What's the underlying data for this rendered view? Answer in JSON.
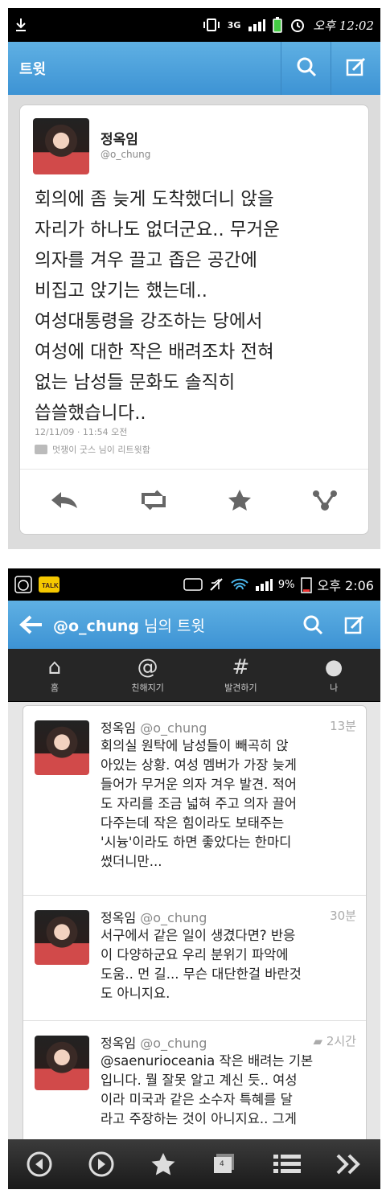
{
  "screen1": {
    "status_time": "오후 12:02",
    "header_title": "트윗",
    "tweet": {
      "name": "정옥임",
      "handle": "@o_chung",
      "lines": [
        "회의에 좀 늦게 도착했더니 앉을",
        "자리가 하나도 없더군요.. 무거운",
        "의자를 겨우 끌고 좁은 공간에",
        "비집고 앉기는 했는데..",
        "여성대통령을 강조하는 당에서",
        "여성에 대한 작은 배려조차 전혀",
        "없는 남성들 문화도 솔직히",
        "씁쓸했습니다.."
      ],
      "timestamp": "12/11/09 · 11:54 오전",
      "retweet_info": "멋쟁이 굿스 님이 리트윗함"
    }
  },
  "screen2": {
    "status_time": "오후 2:06",
    "battery": "9%",
    "header_title_handle": "@o_chung",
    "header_title_suffix": " 님의 트윗",
    "tabs": [
      {
        "label": "홈",
        "icon": "home-icon"
      },
      {
        "label": "친해지기",
        "icon": "at-icon"
      },
      {
        "label": "발견하기",
        "icon": "hash-icon"
      },
      {
        "label": "나",
        "icon": "person-icon"
      }
    ],
    "tweets": [
      {
        "name": "정옥임",
        "handle": "@o_chung",
        "time": "13분",
        "lines": [
          "회의실 원탁에 남성들이 빼곡히 앉",
          "아있는 상황. 여성 멤버가 가장 늦게",
          "들어가 무거운 의자 겨우 발견. 적어",
          "도 자리를 조금 넓혀 주고 의자 끌어",
          "다주는데 작은 힘이라도 보태주는",
          "'시늉'이라도 하면 좋았다는 한마디",
          "썼더니만..."
        ]
      },
      {
        "name": "정옥임",
        "handle": "@o_chung",
        "time": "30분",
        "lines": [
          "서구에서 같은 일이 생겼다면? 반응",
          "이 다양하군요 우리 분위기 파악에",
          "도움.. 먼 길... 무슨 대단한걸 바란것",
          "도 아니지요."
        ]
      },
      {
        "name": "정옥임",
        "handle": "@o_chung",
        "time": "2시간",
        "lines": [
          "@saenurioceania 작은 배려는 기본",
          "입니다. 뭘 잘못 알고 계신 듯.. 여성",
          "이라 미국과 같은 소수자 특혜를 달",
          "라고 주장하는 것이 아니지요.. 그게"
        ]
      }
    ],
    "tab_count": "4"
  }
}
